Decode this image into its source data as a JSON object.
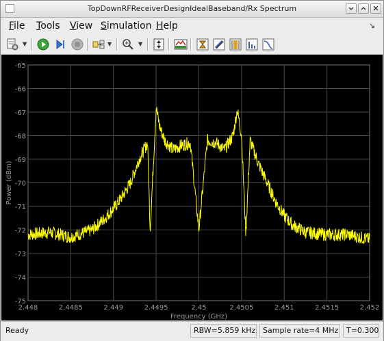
{
  "window": {
    "title": "TopDownRFReceiverDesignIdealBaseband/Rx Spectrum"
  },
  "menu": {
    "items": [
      {
        "label": "File",
        "accel": "F",
        "rest": "ile"
      },
      {
        "label": "Tools",
        "accel": "T",
        "rest": "ools"
      },
      {
        "label": "View",
        "accel": "V",
        "rest": "iew"
      },
      {
        "label": "Simulation",
        "accel": "S",
        "rest": "imulation"
      },
      {
        "label": "Help",
        "accel": "H",
        "rest": "elp"
      }
    ]
  },
  "toolbar": {
    "icons": [
      "settings-icon",
      "play-icon",
      "step-forward-icon",
      "stop-icon",
      "signal-select-icon",
      "zoom-in-icon",
      "autoscale-icon",
      "spectrum-view-icon",
      "measure-cursor-icon",
      "peak-finder-icon",
      "channel-measure-icon",
      "distortion-icon",
      "ccdf-icon"
    ]
  },
  "plot": {
    "colors": {
      "background": "#000000",
      "grid": "#4a4a4a",
      "axis_text": "#999999",
      "trace": "#ffff00"
    }
  },
  "chart_data": {
    "type": "line",
    "title": "",
    "xlabel": "Frequency (GHz)",
    "ylabel": "Power (dBm)",
    "xlim": [
      2.448,
      2.452
    ],
    "ylim": [
      -75,
      -65
    ],
    "x_ticks": [
      "2.448",
      "2.4485",
      "2.449",
      "2.4495",
      "2.45",
      "2.4505",
      "2.451",
      "2.4515",
      "2.452"
    ],
    "y_ticks": [
      "-65",
      "-66",
      "-67",
      "-68",
      "-69",
      "-70",
      "-71",
      "-72",
      "-73",
      "-74",
      "-75"
    ],
    "grid": true,
    "series": [
      {
        "color": "#ffff00",
        "x": [
          2.448,
          2.44825,
          2.4485,
          2.44875,
          2.4489,
          2.449,
          2.4491,
          2.4492,
          2.4493,
          2.4494,
          2.44943,
          2.4495,
          2.44954,
          2.4496,
          2.4497,
          2.4498,
          2.4499,
          2.45,
          2.4501,
          2.4502,
          2.4503,
          2.4504,
          2.45045,
          2.4505,
          2.45055,
          2.4506,
          2.4507,
          2.4508,
          2.4509,
          2.451,
          2.4511,
          2.45125,
          2.4515,
          2.45175,
          2.452
        ],
        "y": [
          -72.2,
          -72.1,
          -72.3,
          -72.0,
          -71.5,
          -71.1,
          -70.6,
          -70.0,
          -69.0,
          -68.3,
          -72.0,
          -66.8,
          -67.6,
          -68.2,
          -68.6,
          -68.4,
          -68.3,
          -72.0,
          -68.2,
          -68.3,
          -68.6,
          -68.0,
          -66.9,
          -68.0,
          -72.2,
          -68.2,
          -69.2,
          -70.0,
          -70.8,
          -71.4,
          -71.8,
          -72.1,
          -72.2,
          -72.2,
          -72.4
        ]
      }
    ]
  },
  "status": {
    "ready": "Ready",
    "rbw": "RBW=5.859 kHz",
    "sample_rate": "Sample rate=4 MHz",
    "time": "T=0.300"
  }
}
